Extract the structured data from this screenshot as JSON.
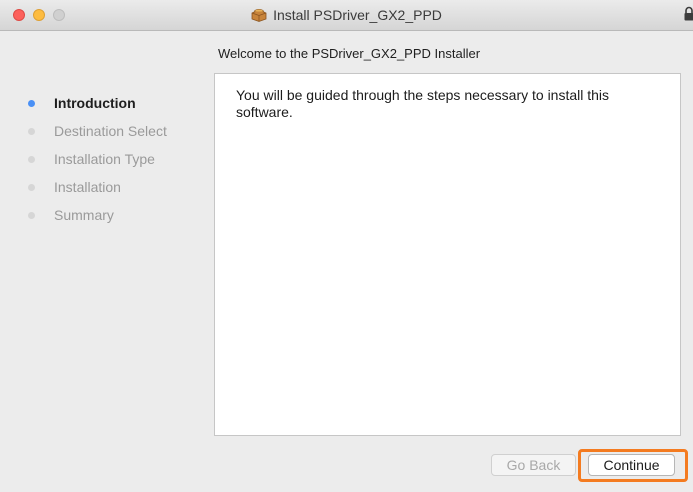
{
  "window": {
    "title": "Install PSDriver_GX2_PPD"
  },
  "heading": "Welcome to the PSDriver_GX2_PPD Installer",
  "sidebar": {
    "steps": [
      {
        "label": "Introduction",
        "active": true
      },
      {
        "label": "Destination Select",
        "active": false
      },
      {
        "label": "Installation Type",
        "active": false
      },
      {
        "label": "Installation",
        "active": false
      },
      {
        "label": "Summary",
        "active": false
      }
    ]
  },
  "content": {
    "text": "You will be guided through the steps necessary to install this software."
  },
  "buttons": {
    "back_label": "Go Back",
    "back_enabled": false,
    "continue_label": "Continue"
  },
  "colors": {
    "active_step": "#4a90f5",
    "highlight": "#f47b20"
  },
  "icons": {
    "title_icon": "package-icon",
    "corner_icon": "lock-icon"
  }
}
